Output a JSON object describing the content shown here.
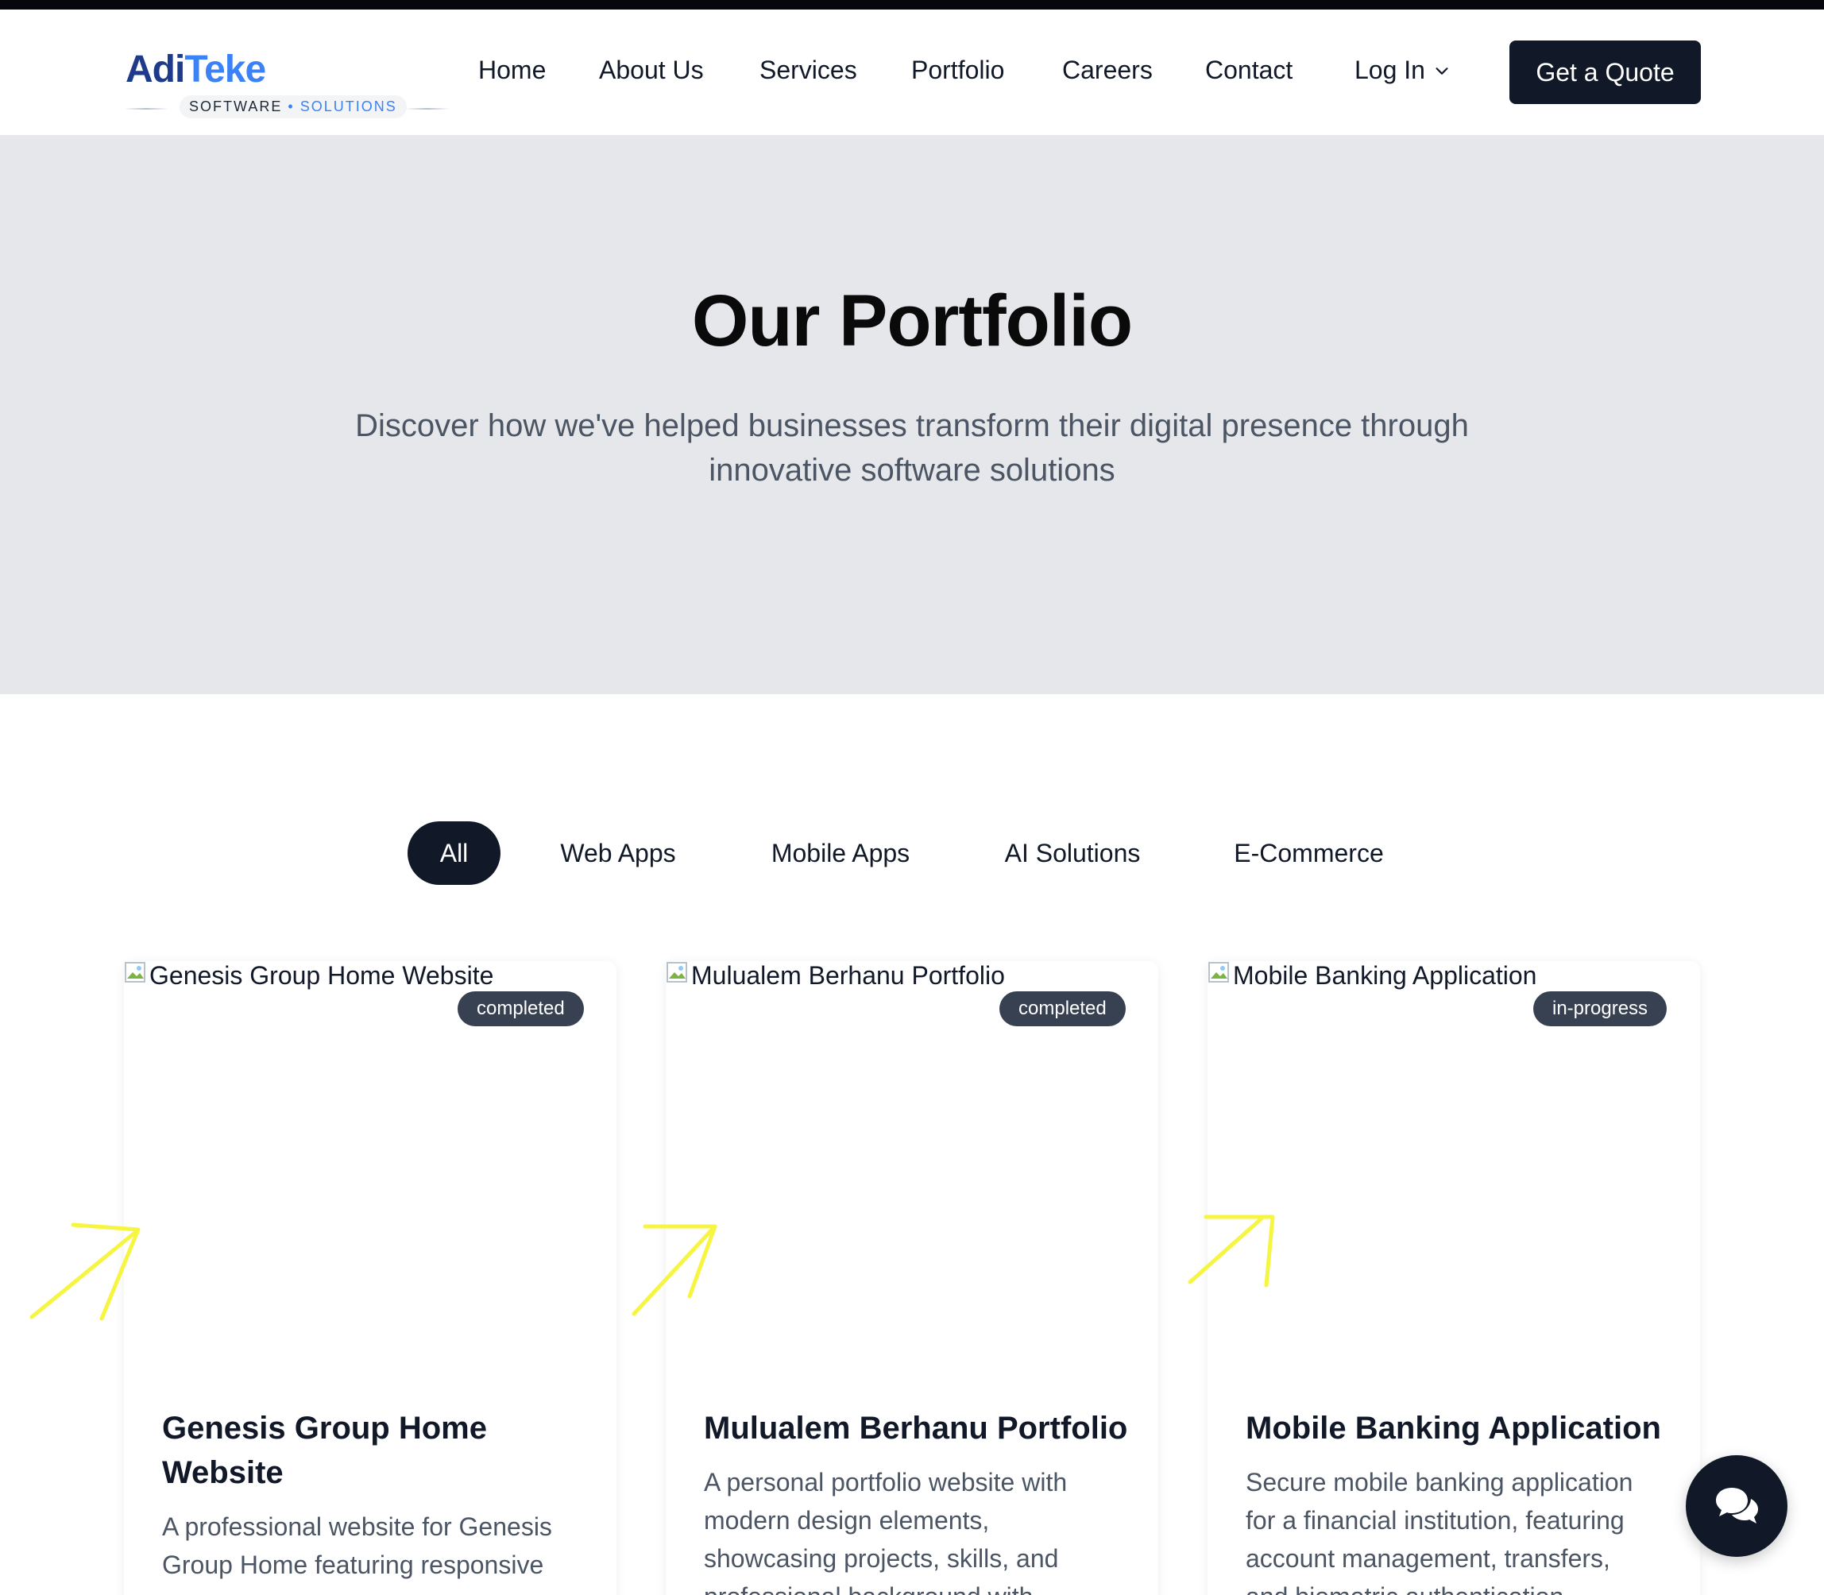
{
  "brand": {
    "name_part1": "Adi",
    "name_part2": "Teke",
    "tagline_part1": "SOFTWARE",
    "tagline_sep": "•",
    "tagline_part2": "SOLUTIONS"
  },
  "nav": {
    "items": [
      "Home",
      "About Us",
      "Services",
      "Portfolio",
      "Careers",
      "Contact"
    ],
    "login_label": "Log In",
    "cta_label": "Get a Quote"
  },
  "hero": {
    "title": "Our Portfolio",
    "subtitle": "Discover how we've helped businesses transform their digital presence through innovative software solutions"
  },
  "filters": {
    "items": [
      "All",
      "Web Apps",
      "Mobile Apps",
      "AI Solutions",
      "E-Commerce"
    ],
    "active": "All"
  },
  "projects": [
    {
      "image_alt": "Genesis Group Home Website",
      "status": "completed",
      "title": "Genesis Group Home Website",
      "description": "A professional website for Genesis Group Home featuring responsive"
    },
    {
      "image_alt": "Mulualem Berhanu Portfolio",
      "status": "completed",
      "title": "Mulualem Berhanu Portfolio",
      "description": "A personal portfolio website with modern design elements, showcasing projects, skills, and professional background with"
    },
    {
      "image_alt": "Mobile Banking Application",
      "status": "in-progress",
      "title": "Mobile Banking Application",
      "description": "Secure mobile banking application for a financial institution, featuring account management, transfers, and biometric authentication"
    }
  ],
  "colors": {
    "primary": "#111827",
    "hero_bg": "#e5e7eb",
    "badge_bg": "#374151",
    "brand_dark": "#1e3a8a",
    "brand_light": "#3b82f6",
    "annotation_arrow": "#f5f542"
  },
  "icons": {
    "login_dropdown": "chevron-down-icon",
    "chat": "chat-bubbles-icon",
    "broken_image": "broken-image-icon"
  }
}
